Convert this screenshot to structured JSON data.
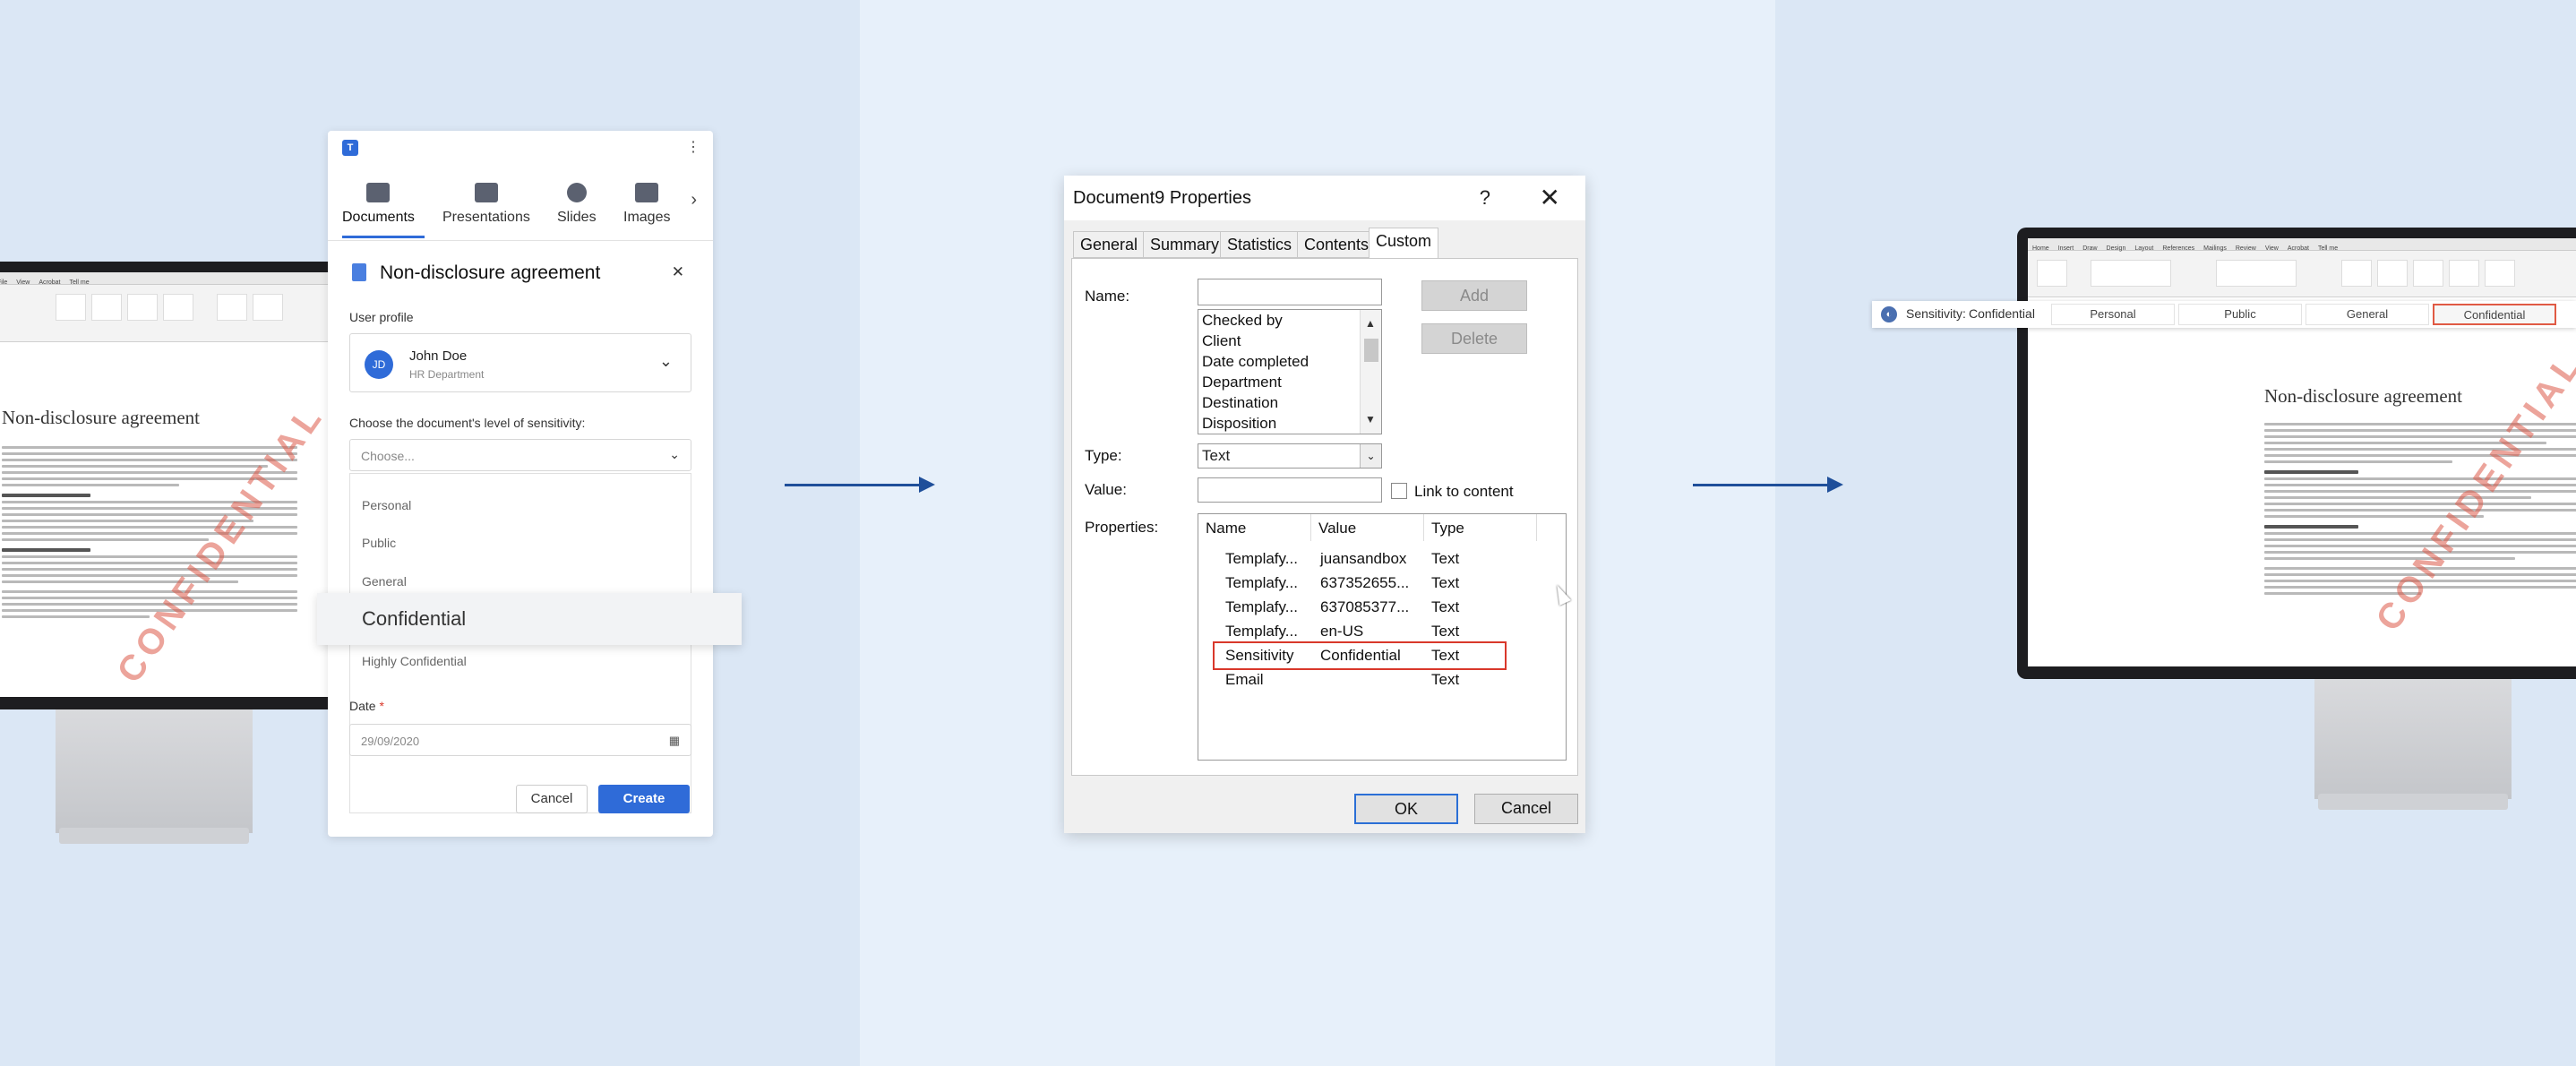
{
  "left_panel": {
    "doc": {
      "title": "Non-disclosure agreement",
      "watermark": "CONFIDENTIAL"
    },
    "templafy": {
      "logo": "T",
      "nav": [
        {
          "label": "Documents",
          "icon": "documents-icon"
        },
        {
          "label": "Presentations",
          "icon": "presentations-icon"
        },
        {
          "label": "Slides",
          "icon": "slides-icon"
        },
        {
          "label": "Images",
          "icon": "images-icon"
        }
      ],
      "doc_title": "Non-disclosure agreement",
      "user_profile_label": "User profile",
      "user": {
        "initials": "JD",
        "name": "John Doe",
        "department": "HR Department"
      },
      "sensitivity_label": "Choose the document's level of sensitivity:",
      "sensitivity_placeholder": "Choose...",
      "options": [
        "Personal",
        "Public",
        "General",
        "Confidential",
        "Highly Confidential"
      ],
      "highlighted_option": "Confidential",
      "date_label": "Date",
      "date_required": "*",
      "date_value": "29/09/2020",
      "cancel_label": "Cancel",
      "create_label": "Create"
    }
  },
  "dialog": {
    "title": "Document9 Properties",
    "help": "?",
    "tabs": [
      "General",
      "Summary",
      "Statistics",
      "Contents",
      "Custom"
    ],
    "active_tab": "Custom",
    "name_label": "Name:",
    "name_list": [
      "Checked by",
      "Client",
      "Date completed",
      "Department",
      "Destination",
      "Disposition"
    ],
    "add_label": "Add",
    "delete_label": "Delete",
    "type_label": "Type:",
    "type_value": "Text",
    "value_label": "Value:",
    "link_label": "Link to content",
    "properties_label": "Properties:",
    "columns": [
      "Name",
      "Value",
      "Type"
    ],
    "rows": [
      {
        "name": "Templafy...",
        "value": "juansandbox",
        "type": "Text"
      },
      {
        "name": "Templafy...",
        "value": "637352655...",
        "type": "Text"
      },
      {
        "name": "Templafy...",
        "value": "637085377...",
        "type": "Text"
      },
      {
        "name": "Templafy...",
        "value": "en-US",
        "type": "Text"
      },
      {
        "name": "Sensitivity",
        "value": "Confidential",
        "type": "Text"
      },
      {
        "name": "Email",
        "value": "",
        "type": "Text"
      }
    ],
    "ok_label": "OK",
    "cancel_label": "Cancel"
  },
  "right_panel": {
    "doc": {
      "title": "Non-disclosure agreement",
      "watermark": "CONFIDENTIAL"
    },
    "sensitivity_bar": {
      "label": "Sensitivity:",
      "current": "Confidential",
      "options": [
        "Personal",
        "Public",
        "General",
        "Confidential"
      ],
      "selected": "Confidential"
    }
  },
  "colors": {
    "accent": "#2f6bd8",
    "arrow": "#1f4f9a",
    "highlight": "#d9382b",
    "watermark": "#dd5a48"
  }
}
